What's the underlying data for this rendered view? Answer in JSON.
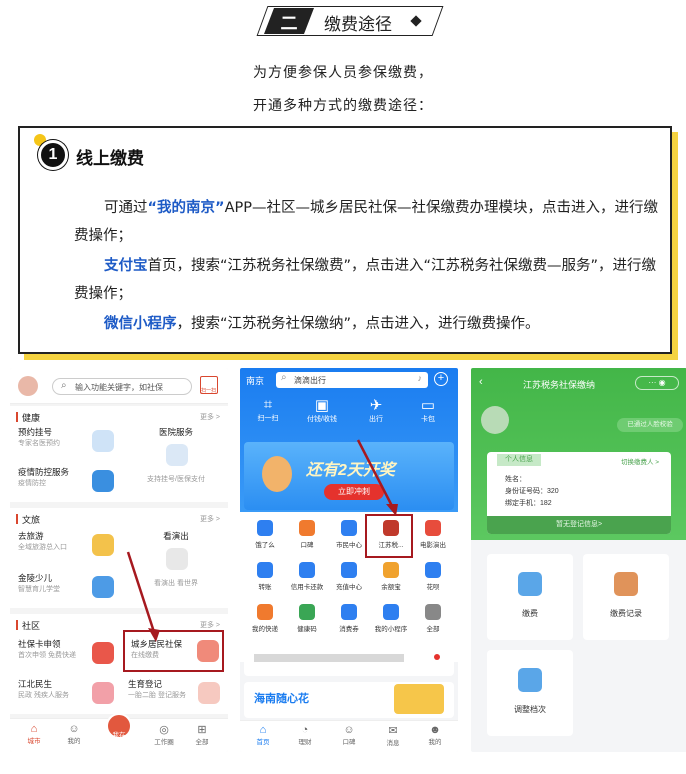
{
  "header": {
    "number": "二",
    "title": "缴费途径"
  },
  "intro": {
    "line1": "为方便参保人员参保缴费，",
    "line2": "开通多种方式的缴费途径："
  },
  "section": {
    "number": "1",
    "title": "线上缴费",
    "p1_pre": "可通过",
    "p1_hl": "“我的南京”",
    "p1_post": "APP—社区—城乡居民社保—社保缴费办理模块，点击进入，进行缴费操作；",
    "p2_hl": "支付宝",
    "p2_post": "首页，搜索“江苏税务社保缴费”，点击进入“江苏税务社保缴费—服务”，进行缴费操作；",
    "p3_hl": "微信小程序",
    "p3_post": "，搜索“江苏税务社保缴纳”，点击进入，进行缴费操作。"
  },
  "phone1": {
    "search_placeholder": "输入功能关键字，如社保",
    "scan_label": "扫一扫",
    "sections": [
      {
        "title": "健康",
        "more": "更多 >",
        "items": [
          {
            "title": "预约挂号",
            "sub": "专家名医预约"
          },
          {
            "title": "医院服务",
            "sub": "支持挂号/医保支付"
          },
          {
            "title": "疫情防控服务",
            "sub": "疫情防控"
          }
        ]
      },
      {
        "title": "文旅",
        "more": "更多 >",
        "items": [
          {
            "title": "去旅游",
            "sub": "全域旅游总入口"
          },
          {
            "title": "看演出",
            "sub": "看演出  看世界"
          },
          {
            "title": "金陵少儿",
            "sub": "智慧育儿学堂"
          }
        ]
      },
      {
        "title": "社区",
        "more": "更多 >",
        "items": [
          {
            "title": "社保卡申领",
            "sub": "首次申领 免费快递"
          },
          {
            "title": "城乡居民社保",
            "sub": "在线缴费"
          },
          {
            "title": "江北民生",
            "sub": "民政 残疾人服务"
          },
          {
            "title": "生育登记",
            "sub": "一胎二胎 登记服务"
          }
        ]
      }
    ],
    "nav": [
      "城市",
      "我的",
      "我在",
      "工作圈",
      "全部"
    ]
  },
  "phone2": {
    "city": "南京",
    "search_placeholder": "滴滴出行",
    "top_actions": [
      "扫一扫",
      "付钱/收钱",
      "出行",
      "卡包"
    ],
    "banner": "还有2天开奖",
    "banner_btn": "立即冲刺",
    "grid": [
      "饿了么",
      "口碑",
      "市民中心",
      "江苏税...",
      "电影演出",
      "转账",
      "信用卡还款",
      "充值中心",
      "余额宝",
      "花呗",
      "我的快递",
      "健康码",
      "消费券",
      "我的小程序",
      "全部"
    ],
    "promo": "海南随心花",
    "nav": [
      "首页",
      "理财",
      "口碑",
      "消息",
      "我的"
    ]
  },
  "phone3": {
    "title": "江苏税务社保缴纳",
    "link": "已通过人脸校验",
    "card_tab": "个人信息",
    "switch": "切换缴费人 >",
    "name_label": "姓名：",
    "id_label": "身份证号码：",
    "id_value": "320",
    "phone_label": "绑定手机：",
    "phone_value": "182",
    "more": "暂无登记信息>",
    "tiles": [
      "缴费",
      "缴费记录",
      "调整档次"
    ]
  }
}
